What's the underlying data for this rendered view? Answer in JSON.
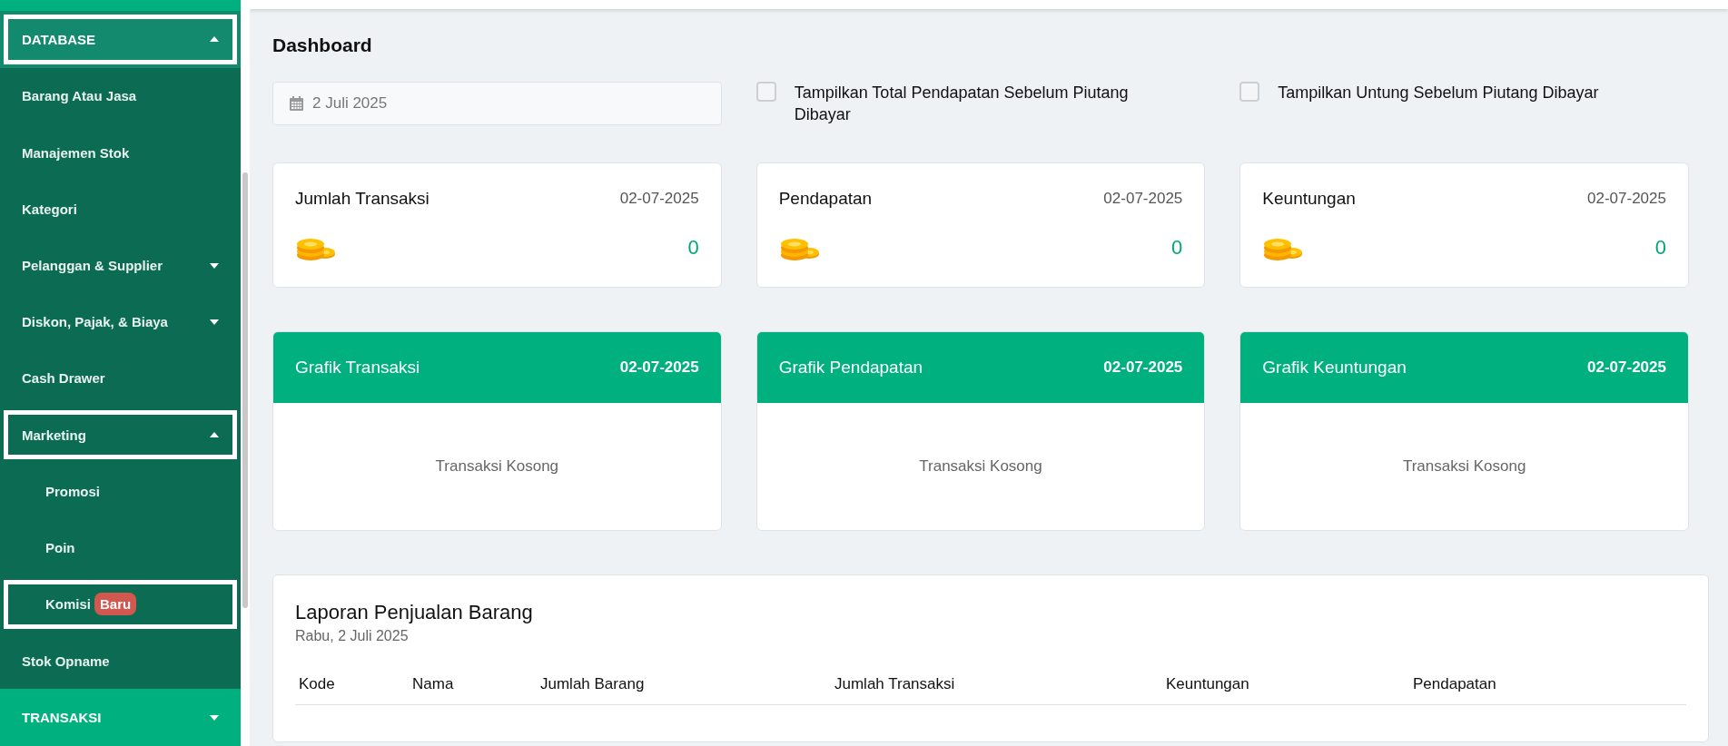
{
  "sidebar": {
    "sections": [
      {
        "label": "DATABASE",
        "expanded": true,
        "highlighted": true,
        "items": [
          {
            "label": "Barang Atau Jasa",
            "kind": "link",
            "highlighted": false
          },
          {
            "label": "Manajemen Stok",
            "kind": "link",
            "highlighted": false
          },
          {
            "label": "Kategori",
            "kind": "link",
            "highlighted": false
          },
          {
            "label": "Pelanggan & Supplier",
            "kind": "group",
            "expanded": false,
            "highlighted": false
          },
          {
            "label": "Diskon, Pajak, & Biaya",
            "kind": "group",
            "expanded": false,
            "highlighted": false
          },
          {
            "label": "Cash Drawer",
            "kind": "link",
            "highlighted": false
          },
          {
            "label": "Marketing",
            "kind": "group",
            "expanded": true,
            "highlighted": true,
            "children": [
              {
                "label": "Promosi",
                "highlighted": false
              },
              {
                "label": "Poin",
                "highlighted": false
              },
              {
                "label": "Komisi",
                "badge": "Baru",
                "highlighted": true
              }
            ]
          },
          {
            "label": "Stok Opname",
            "kind": "link",
            "highlighted": false
          }
        ]
      },
      {
        "label": "TRANSAKSI",
        "expanded": false,
        "highlighted": false
      }
    ]
  },
  "page_title": "Dashboard",
  "date_field": {
    "value": "2 Juli 2025"
  },
  "options": [
    {
      "label": "Tampilkan Total Pendapatan Sebelum Piutang Dibayar",
      "checked": false
    },
    {
      "label": "Tampilkan Untung Sebelum Piutang Dibayar",
      "checked": false
    }
  ],
  "stat_cards": [
    {
      "title": "Jumlah Transaksi",
      "date": "02-07-2025",
      "value": "0"
    },
    {
      "title": "Pendapatan",
      "date": "02-07-2025",
      "value": "0"
    },
    {
      "title": "Keuntungan",
      "date": "02-07-2025",
      "value": "0"
    }
  ],
  "chart_cards": [
    {
      "title": "Grafik Transaksi",
      "date": "02-07-2025",
      "empty_text": "Transaksi Kosong"
    },
    {
      "title": "Grafik Pendapatan",
      "date": "02-07-2025",
      "empty_text": "Transaksi Kosong"
    },
    {
      "title": "Grafik Keuntungan",
      "date": "02-07-2025",
      "empty_text": "Transaksi Kosong"
    }
  ],
  "report": {
    "title": "Laporan Penjualan Barang",
    "subtitle": "Rabu, 2 Juli 2025",
    "columns": [
      "Kode",
      "Nama",
      "Jumlah Barang",
      "Jumlah Transaksi",
      "Keuntungan",
      "Pendapatan"
    ]
  }
}
